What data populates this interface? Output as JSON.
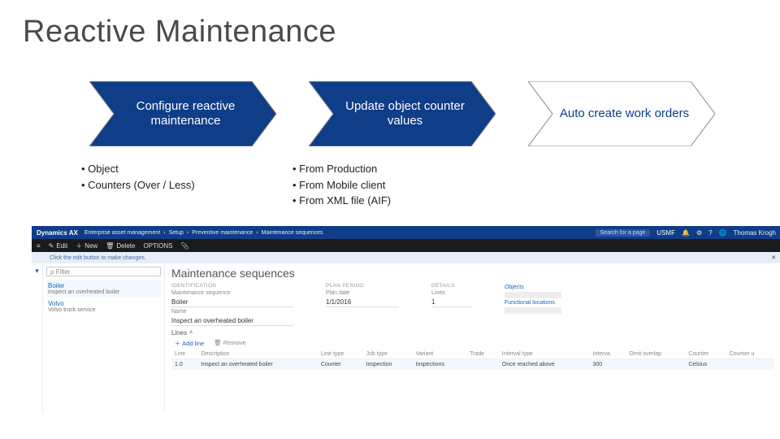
{
  "title": "Reactive Maintenance",
  "chevrons": [
    {
      "label": "Configure reactive maintenance",
      "style": "blue"
    },
    {
      "label": "Update object counter values",
      "style": "blue"
    },
    {
      "label": "Auto create work orders",
      "style": "white"
    }
  ],
  "bullets": {
    "col1": [
      "Object",
      "Counters (Over / Less)"
    ],
    "col2": [
      "From Production",
      "From Mobile client",
      "From XML file (AIF)"
    ]
  },
  "app": {
    "brand": "Dynamics AX",
    "breadcrumb": [
      "Enterprise asset management",
      "Setup",
      "Preventive maintenance",
      "Maintenance sequences"
    ],
    "search_placeholder": "Search for a page",
    "user": "USMF",
    "user_name": "Thomas Krogh",
    "toolbar": {
      "edit": "Edit",
      "new": "New",
      "delete": "Delete",
      "options": "OPTIONS"
    },
    "infobar": "Click the edit button to make changes.",
    "filter_placeholder": "Filter",
    "list": [
      {
        "h": "Boiler",
        "s": "Inspect an overheated boiler",
        "sel": true
      },
      {
        "h": "Volvo",
        "s": "Volvo truck service",
        "sel": false
      }
    ],
    "main_heading": "Maintenance sequences",
    "sections": {
      "id": "IDENTIFICATION",
      "plan": "PLAN PERIOD",
      "det": "DETAILS",
      "obj": "Objects",
      "loc": "Functional locations"
    },
    "fields": {
      "seq_lbl": "Maintenance sequence",
      "seq_val": "Boiler",
      "name_lbl": "Name",
      "name_val": "Inspect an overheated boiler",
      "plan_lbl": "Plan date",
      "plan_val": "1/1/2016",
      "lines_lbl": "Lines",
      "lines_val": "1"
    },
    "lines": {
      "header": "Lines",
      "add": "Add line",
      "remove": "Remove",
      "cols": [
        "Line",
        "Description",
        "Line type",
        "Job type",
        "Variant",
        "Trade",
        "Interval type",
        "Interva",
        "Omit overlap",
        "Counter",
        "Counter u"
      ],
      "row": [
        "1.0",
        "Inspect an overheated boiler",
        "Counter",
        "Inspection",
        "Inspections",
        "",
        "Once reached above",
        "300",
        "",
        "Celsius",
        ""
      ]
    }
  }
}
